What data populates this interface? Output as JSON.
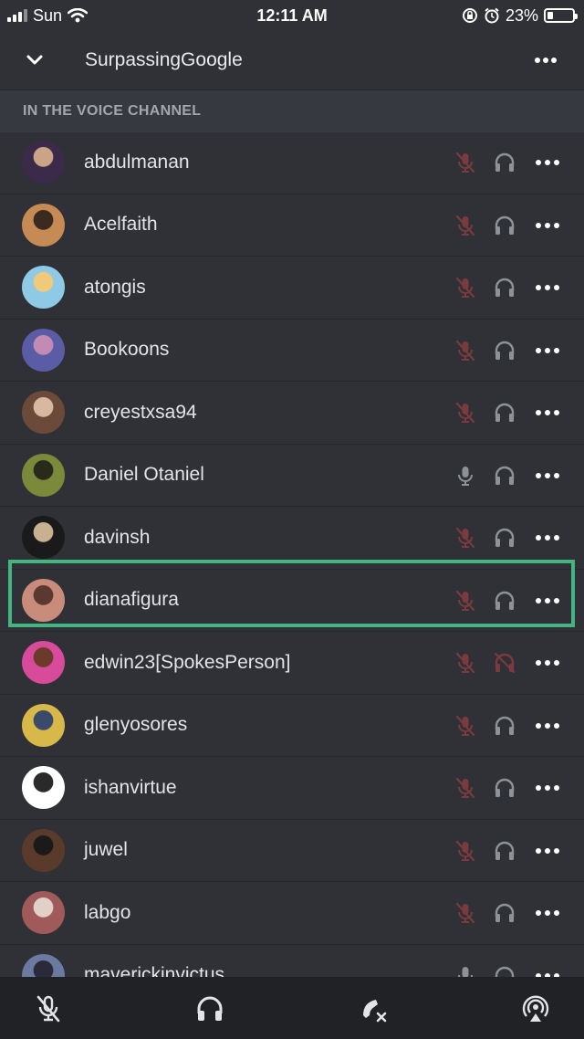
{
  "status_bar": {
    "carrier": "Sun",
    "time": "12:11 AM",
    "battery": "23%",
    "battery_level": 0.23
  },
  "header": {
    "title": "SurpassingGoogle",
    "back_icon": "chevron-down-icon",
    "menu_icon": "more-horizontal-icon"
  },
  "section": {
    "title": "IN THE VOICE CHANNEL"
  },
  "members": [
    {
      "name": "abdulmanan",
      "mic": "muted",
      "headphones": "on",
      "avatar_colors": [
        "#3b2a4a",
        "#c9a487"
      ]
    },
    {
      "name": "Acelfaith",
      "mic": "muted",
      "headphones": "on",
      "avatar_colors": [
        "#c68a55",
        "#3a2a20"
      ]
    },
    {
      "name": "atongis",
      "mic": "muted",
      "headphones": "on",
      "avatar_colors": [
        "#8ec9e6",
        "#f0c97a"
      ]
    },
    {
      "name": "Bookoons",
      "mic": "muted",
      "headphones": "on",
      "avatar_colors": [
        "#5b5ca6",
        "#c28bb4"
      ]
    },
    {
      "name": "creyestxsa94",
      "mic": "muted",
      "headphones": "on",
      "avatar_colors": [
        "#6b4a3a",
        "#d8b8a0"
      ]
    },
    {
      "name": "Daniel Otaniel",
      "mic": "on",
      "headphones": "on",
      "avatar_colors": [
        "#7a8a3a",
        "#2a2a1a"
      ]
    },
    {
      "name": "davinsh",
      "mic": "muted",
      "headphones": "on",
      "avatar_colors": [
        "#1a1a1a",
        "#c8b090"
      ]
    },
    {
      "name": "dianafigura",
      "mic": "muted",
      "headphones": "on",
      "avatar_colors": [
        "#c98b7a",
        "#5a3a30"
      ]
    },
    {
      "name": "edwin23[SpokesPerson]",
      "mic": "muted",
      "headphones": "deafened",
      "avatar_colors": [
        "#d84a9a",
        "#6b3a2a"
      ]
    },
    {
      "name": "glenyosores",
      "mic": "muted",
      "headphones": "on",
      "avatar_colors": [
        "#d8b848",
        "#3a4a6a"
      ]
    },
    {
      "name": "ishanvirtue",
      "mic": "muted",
      "headphones": "on",
      "avatar_colors": [
        "#ffffff",
        "#2a2a2a"
      ]
    },
    {
      "name": "juwel",
      "mic": "muted",
      "headphones": "on",
      "avatar_colors": [
        "#5a3a2a",
        "#1a1a1a"
      ]
    },
    {
      "name": "labgo",
      "mic": "muted",
      "headphones": "on",
      "avatar_colors": [
        "#a05a5a",
        "#e0d0c8"
      ]
    },
    {
      "name": "maverickinvictus",
      "mic": "on",
      "headphones": "on",
      "avatar_colors": [
        "#6a7aa0",
        "#2a2a3a"
      ]
    }
  ],
  "bottom_bar": {
    "icons": [
      "mute-microphone-icon",
      "headphones-icon",
      "disconnect-call-icon",
      "broadcast-icon"
    ]
  },
  "colors": {
    "background": "#2f3136",
    "section": "#36393f",
    "muted_red": "#7a3a3e",
    "icon_gray": "#8e9297",
    "highlight": "#43b581",
    "bottom_bar": "#202225"
  }
}
